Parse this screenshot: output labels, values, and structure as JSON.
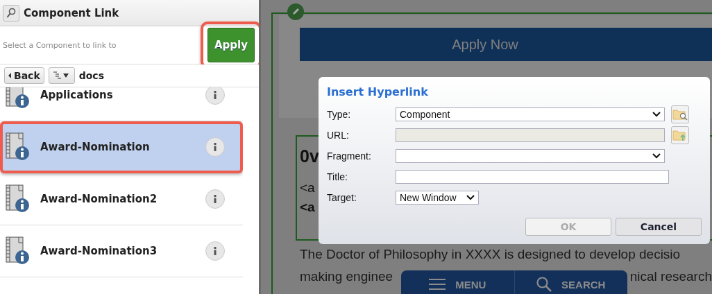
{
  "panel": {
    "title": "Component Link",
    "instruction": "Select a Component to link to",
    "apply_button": {
      "label": "Apply",
      "highlighted": true
    },
    "back_button": "Back",
    "path": "docs",
    "items": [
      {
        "name": "Applications",
        "selected": false
      },
      {
        "name": "Award-Nomination",
        "selected": true
      },
      {
        "name": "Award-Nomination2",
        "selected": false
      },
      {
        "name": "Award-Nomination3",
        "selected": false
      }
    ]
  },
  "page": {
    "banner": "Apply Now",
    "heading": "0v",
    "lines": [
      {
        "text": "<a",
        "bold": false
      },
      {
        "text": "<a",
        "bold": true
      }
    ],
    "paragraph_line_1": "The Doctor of Philosophy in XXXX is designed to develop decisio",
    "paragraph_line_2": [
      "making enginee",
      "nical research"
    ],
    "nav": [
      {
        "kind": "menu",
        "label": "MENU"
      },
      {
        "kind": "search",
        "label": "SEARCH"
      }
    ]
  },
  "dialog": {
    "title": "Insert Hyperlink",
    "fields": [
      {
        "kind": "select",
        "label": "Type:",
        "value": "Component",
        "browse_button": true,
        "disabled": false
      },
      {
        "kind": "text",
        "label": "URL:",
        "upload_button": true,
        "disabled": true
      },
      {
        "kind": "select",
        "label": "Fragment:",
        "disabled": false
      },
      {
        "kind": "text",
        "label": "Title:",
        "disabled": false
      },
      {
        "kind": "compact-select",
        "label": "Target:",
        "value": "New Window",
        "disabled": false
      }
    ],
    "buttons": [
      {
        "label": "OK",
        "disabled": true
      },
      {
        "label": "Cancel",
        "disabled": false
      }
    ]
  }
}
